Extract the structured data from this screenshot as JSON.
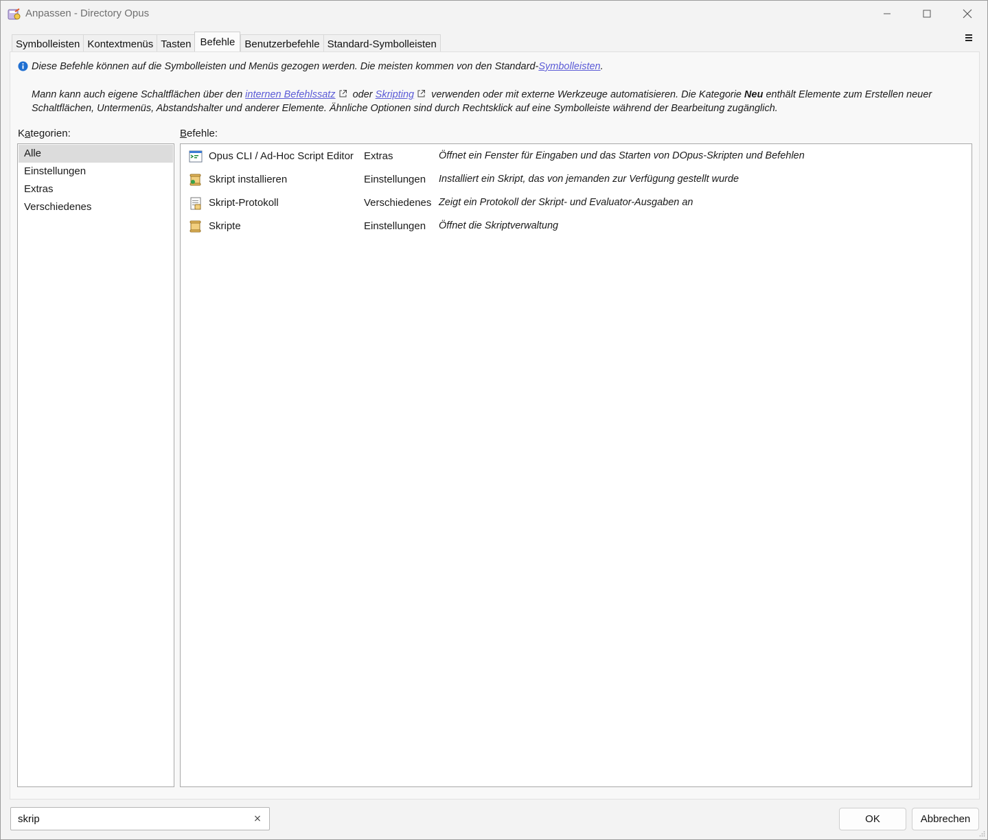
{
  "window": {
    "title": "Anpassen - Directory Opus"
  },
  "tabs": [
    {
      "label": "Symbolleisten",
      "active": false
    },
    {
      "label": "Kontextmenüs",
      "active": false
    },
    {
      "label": "Tasten",
      "active": false
    },
    {
      "label": "Befehle",
      "active": true
    },
    {
      "label": "Benutzerbefehle",
      "active": false
    },
    {
      "label": "Standard-Symbolleisten",
      "active": false
    }
  ],
  "info": {
    "line1_text": "Diese Befehle können auf die Symbolleisten und Menüs gezogen werden. Die meisten kommen von den Standard-",
    "line1_link": "Symbolleisten",
    "line1_end": ".",
    "para_part1": "Mann kann auch eigene Schaltflächen über den ",
    "para_link1": "internen Befehlssatz",
    "para_part2": " oder ",
    "para_link2": "Skripting",
    "para_part3": " verwenden oder mit externe Werkzeuge automatisieren. Die Kategorie ",
    "para_bold": "Neu",
    "para_part4": " enthält Elemente zum Erstellen neuer Schaltflächen, Untermenüs, Abstandshalter und anderer Elemente. Ähnliche Optionen sind durch Rechtsklick auf eine Symbolleiste während der Bearbeitung zugänglich."
  },
  "categories": {
    "label_prefix": "K",
    "label_access": "a",
    "label_rest": "tegorien:",
    "items": [
      "Alle",
      "Einstellungen",
      "Extras",
      "Verschiedenes"
    ],
    "selected": "Alle"
  },
  "commands": {
    "label_access": "B",
    "label_rest": "efehle:",
    "rows": [
      {
        "name": "Opus CLI / Ad-Hoc Script Editor",
        "category": "Extras",
        "description": "Öffnet ein Fenster für Eingaben und das Starten von DOpus-Skripten und Befehlen",
        "icon": "cli-window-icon"
      },
      {
        "name": "Skript installieren",
        "category": "Einstellungen",
        "description": "Installiert ein Skript, das von jemanden zur Verfügung gestellt wurde",
        "icon": "script-install-icon"
      },
      {
        "name": "Skript-Protokoll",
        "category": "Verschiedenes",
        "description": "Zeigt ein Protokoll der Skript- und Evaluator-Ausgaben an",
        "icon": "script-log-icon"
      },
      {
        "name": "Skripte",
        "category": "Einstellungen",
        "description": "Öffnet die Skriptverwaltung",
        "icon": "script-scroll-icon"
      }
    ]
  },
  "search": {
    "value": "skrip",
    "clear_label": "×"
  },
  "buttons": {
    "ok": "OK",
    "cancel": "Abbrechen"
  },
  "colors": {
    "link": "#5a5ad6",
    "selection": "#dcdcdc",
    "info_icon": "#1f6fd1"
  }
}
